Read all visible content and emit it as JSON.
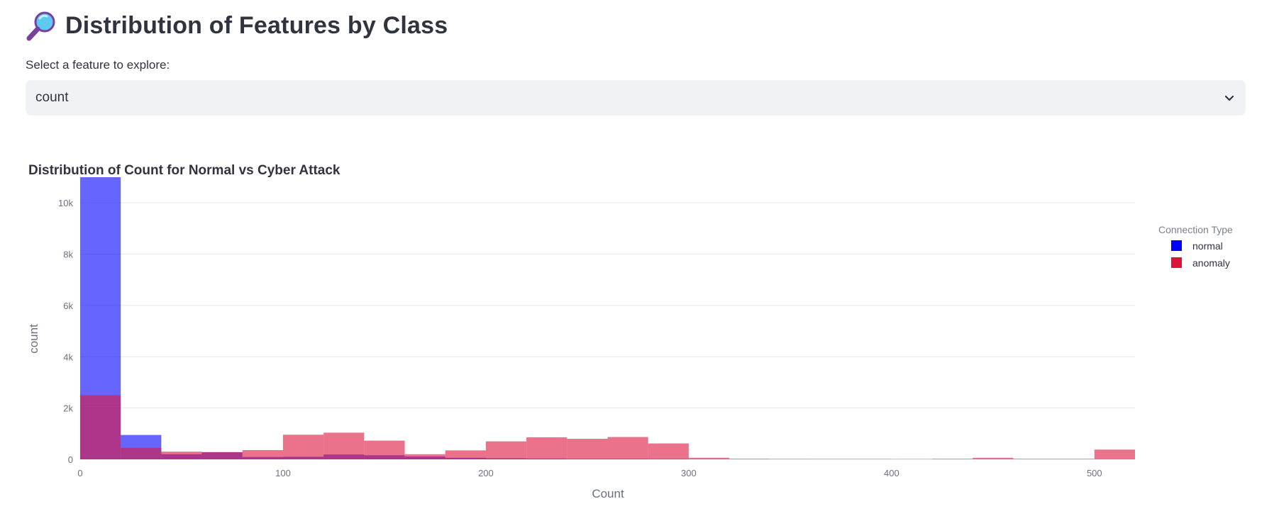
{
  "page": {
    "title": "Distribution of Features by Class",
    "title_icon": "magnifying-glass-icon"
  },
  "selector": {
    "label": "Select a feature to explore:",
    "value": "count",
    "icon": "chevron-down-icon"
  },
  "chart_data": {
    "type": "bar",
    "title": "Distribution of Count for Normal vs Cyber Attack",
    "xlabel": "Count",
    "ylabel": "count",
    "xlim": [
      0,
      520
    ],
    "ylim": [
      0,
      11000
    ],
    "x_ticks": [
      0,
      100,
      200,
      300,
      400,
      500
    ],
    "x_tick_labels": [
      "0",
      "100",
      "200",
      "300",
      "400",
      "500"
    ],
    "y_ticks": [
      0,
      2000,
      4000,
      6000,
      8000,
      10000
    ],
    "y_tick_labels": [
      "0",
      "2k",
      "4k",
      "6k",
      "8k",
      "10k"
    ],
    "grid": true,
    "barmode": "overlay",
    "bin_width": 20,
    "bin_starts": [
      0,
      20,
      40,
      60,
      80,
      100,
      120,
      140,
      160,
      180,
      200,
      220,
      240,
      260,
      280,
      300,
      320,
      340,
      360,
      380,
      400,
      420,
      440,
      460,
      480,
      500
    ],
    "legend": {
      "title": "Connection Type",
      "position": "top-right"
    },
    "series": [
      {
        "name": "normal",
        "color": "#0000ff",
        "values": [
          11000,
          950,
          200,
          280,
          90,
          100,
          190,
          160,
          110,
          60,
          40,
          30,
          20,
          20,
          15,
          5,
          5,
          5,
          3,
          3,
          3,
          3,
          2,
          2,
          2,
          1
        ]
      },
      {
        "name": "anomaly",
        "color": "#dc143c",
        "values": [
          2500,
          450,
          300,
          280,
          360,
          960,
          1040,
          730,
          200,
          350,
          700,
          860,
          800,
          870,
          620,
          60,
          20,
          15,
          15,
          15,
          10,
          20,
          60,
          20,
          20,
          380
        ]
      }
    ]
  }
}
